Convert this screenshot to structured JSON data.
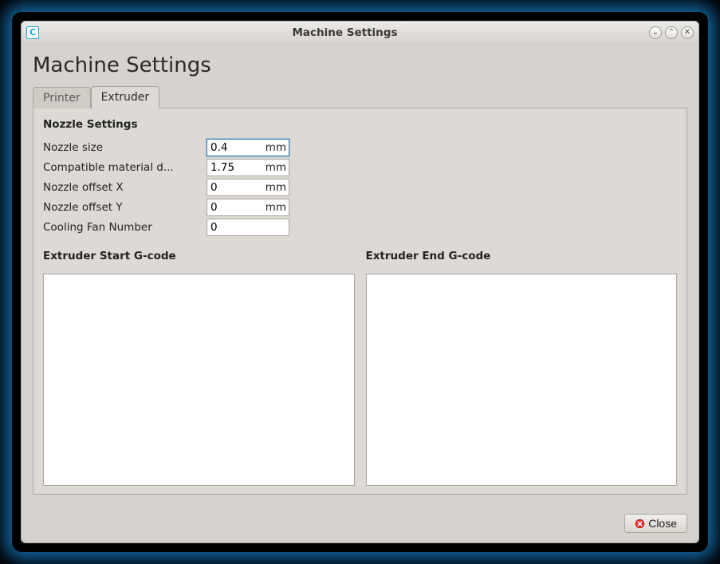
{
  "window": {
    "title": "Machine Settings"
  },
  "page": {
    "heading": "Machine Settings"
  },
  "tabs": {
    "printer": "Printer",
    "extruder": "Extruder",
    "active": "extruder"
  },
  "nozzle": {
    "section_title": "Nozzle Settings",
    "rows": {
      "size": {
        "label": "Nozzle size",
        "value": "0.4",
        "unit": "mm"
      },
      "diam": {
        "label": "Compatible material d...",
        "value": "1.75",
        "unit": "mm"
      },
      "offsetx": {
        "label": "Nozzle offset X",
        "value": "0",
        "unit": "mm"
      },
      "offsety": {
        "label": "Nozzle offset Y",
        "value": "0",
        "unit": "mm"
      },
      "fan": {
        "label": "Cooling Fan Number",
        "value": "0",
        "unit": ""
      }
    }
  },
  "gcode": {
    "start": {
      "title": "Extruder Start G-code",
      "value": ""
    },
    "end": {
      "title": "Extruder End G-code",
      "value": ""
    }
  },
  "footer": {
    "close_label": "Close"
  },
  "icons": {
    "app": "C",
    "minimize": "⌄",
    "maximize": "⌃",
    "close_tb": "✕"
  }
}
